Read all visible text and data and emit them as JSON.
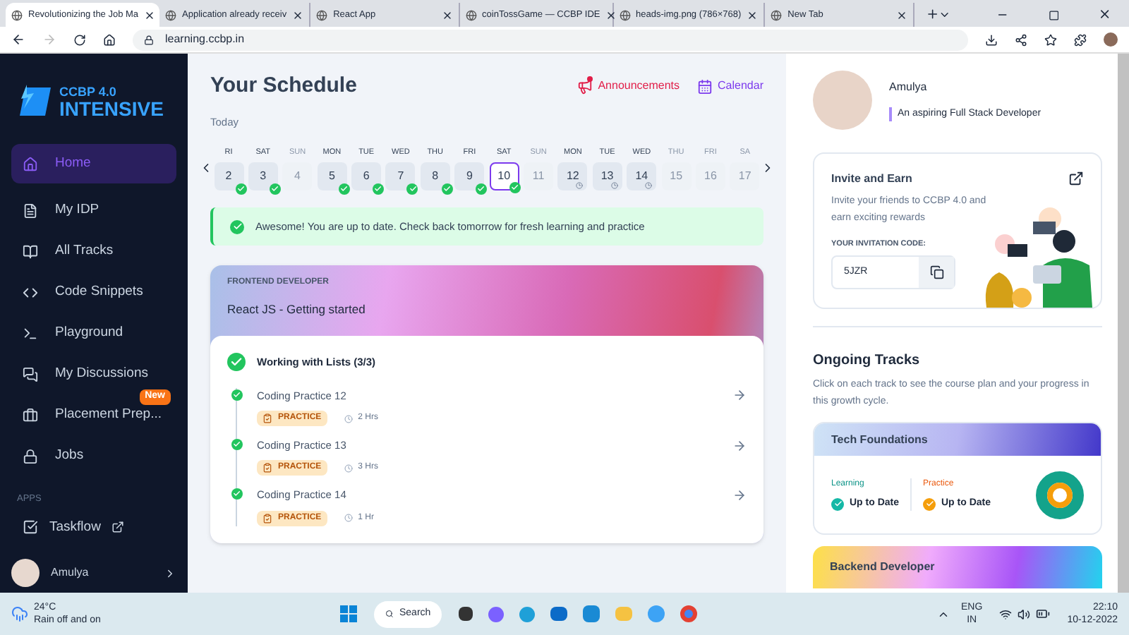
{
  "browser": {
    "tabs": [
      {
        "title": "Revolutionizing the Job Ma",
        "selected": true
      },
      {
        "title": "Application already receiv",
        "selected": false
      },
      {
        "title": "React App",
        "selected": false
      },
      {
        "title": "coinTossGame — CCBP IDE",
        "selected": false
      },
      {
        "title": "heads-img.png (786×768)",
        "selected": false
      },
      {
        "title": "New Tab",
        "selected": false
      }
    ],
    "address": "learning.ccbp.in"
  },
  "sidebar": {
    "logo_top": "CCBP 4.0",
    "logo_bottom": "INTENSIVE",
    "nav": [
      {
        "label": "Home",
        "kind": "home",
        "selected": true
      },
      {
        "label": "My IDP",
        "kind": "file",
        "selected": false
      },
      {
        "label": "All Tracks",
        "kind": "book",
        "selected": false
      },
      {
        "label": "Code Snippets",
        "kind": "code",
        "selected": false
      },
      {
        "label": "Playground",
        "kind": "terminal",
        "selected": false
      },
      {
        "label": "My Discussions",
        "kind": "chat",
        "selected": false
      },
      {
        "label": "Placement Prep...",
        "kind": "placement",
        "selected": false,
        "badge": "New"
      },
      {
        "label": "Jobs",
        "kind": "jobs",
        "selected": false
      }
    ],
    "apps_heading": "APPS",
    "apps": [
      {
        "label": "Taskflow"
      }
    ],
    "user": "Amulya"
  },
  "schedule": {
    "title": "Your Schedule",
    "announcements": "Announcements",
    "calendar": "Calendar",
    "today": "Today",
    "days": [
      {
        "day": "RI",
        "date": "2",
        "kind": "done",
        "selected": false
      },
      {
        "day": "SAT",
        "date": "3",
        "kind": "done",
        "selected": false
      },
      {
        "day": "SUN",
        "date": "4",
        "kind": "off",
        "selected": false
      },
      {
        "day": "MON",
        "date": "5",
        "kind": "done",
        "selected": false
      },
      {
        "day": "TUE",
        "date": "6",
        "kind": "done",
        "selected": false
      },
      {
        "day": "WED",
        "date": "7",
        "kind": "done",
        "selected": false
      },
      {
        "day": "THU",
        "date": "8",
        "kind": "done",
        "selected": false
      },
      {
        "day": "FRI",
        "date": "9",
        "kind": "done",
        "selected": false
      },
      {
        "day": "SAT",
        "date": "10",
        "kind": "done",
        "selected": true
      },
      {
        "day": "SUN",
        "date": "11",
        "kind": "off",
        "selected": false
      },
      {
        "day": "MON",
        "date": "12",
        "kind": "pending",
        "selected": false
      },
      {
        "day": "TUE",
        "date": "13",
        "kind": "pending",
        "selected": false
      },
      {
        "day": "WED",
        "date": "14",
        "kind": "pending",
        "selected": false
      },
      {
        "day": "THU",
        "date": "15",
        "kind": "off",
        "selected": false
      },
      {
        "day": "FRI",
        "date": "16",
        "kind": "off",
        "selected": false
      },
      {
        "day": "SA",
        "date": "17",
        "kind": "off",
        "selected": false
      }
    ],
    "banner": "Awesome! You are up to date. Check back tomorrow for fresh learning and practice"
  },
  "course": {
    "track": "FRONTEND DEVELOPER",
    "title": "React JS - Getting started",
    "module": {
      "title": "Working with Lists (3/3)",
      "done": true
    },
    "items": [
      {
        "title": "Coding Practice 12",
        "tag": "PRACTICE",
        "duration": "2 Hrs",
        "done": true
      },
      {
        "title": "Coding Practice 13",
        "tag": "PRACTICE",
        "duration": "3 Hrs",
        "done": true
      },
      {
        "title": "Coding Practice 14",
        "tag": "PRACTICE",
        "duration": "1 Hr",
        "done": true
      }
    ]
  },
  "profile": {
    "name": "Amulya",
    "tagline": "An aspiring Full Stack Developer"
  },
  "invite": {
    "title": "Invite and Earn",
    "text": "Invite your friends to CCBP 4.0 and earn exciting rewards",
    "code_label": "YOUR INVITATION CODE:",
    "code": "5JZR"
  },
  "ongoing": {
    "title": "Ongoing Tracks",
    "text": "Click on each track to see the course plan and your progress in this growth cycle.",
    "tracks": [
      {
        "name": "Tech Foundations",
        "learning_label": "Learning",
        "learning_status": "Up to Date",
        "practice_label": "Practice",
        "practice_status": "Up to Date"
      }
    ],
    "next_track": "Backend Developer"
  },
  "taskbar": {
    "temp": "24°C",
    "weather": "Rain off and on",
    "search": "Search",
    "lang": "ENG",
    "region": "IN",
    "time": "22:10",
    "date": "10-12-2022"
  }
}
